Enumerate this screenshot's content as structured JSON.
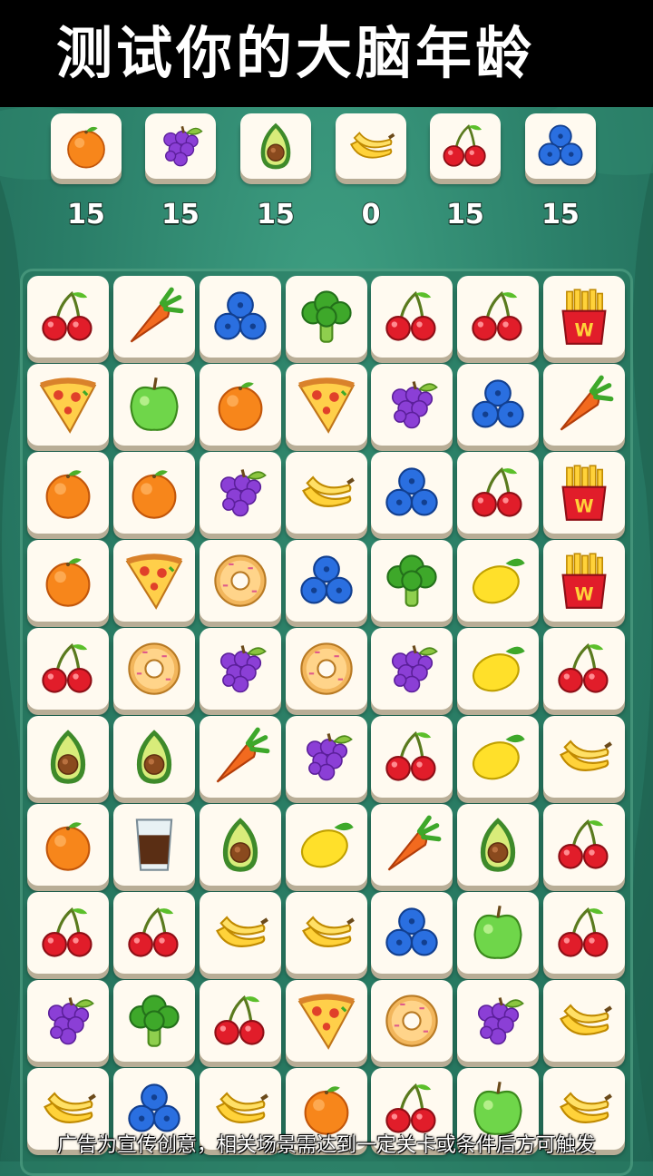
{
  "title": "测试你的大脑年龄",
  "targets": [
    {
      "icon": "orange-icon",
      "count": "15"
    },
    {
      "icon": "grapes-icon",
      "count": "15"
    },
    {
      "icon": "avocado-icon",
      "count": "15"
    },
    {
      "icon": "banana-icon",
      "count": "0"
    },
    {
      "icon": "cherry-icon",
      "count": "15"
    },
    {
      "icon": "blueberry-icon",
      "count": "15"
    }
  ],
  "board": {
    "rows": [
      [
        "cherry-icon",
        "carrot-icon",
        "blueberry-icon",
        "broccoli-icon",
        "cherry-icon",
        "cherry-icon",
        "fries-icon"
      ],
      [
        "pizza-icon",
        "apple-icon",
        "orange-icon",
        "pizza-icon",
        "grapes-icon",
        "blueberry-icon",
        "carrot-icon"
      ],
      [
        "orange-icon",
        "orange-icon",
        "grapes-icon",
        "banana-icon",
        "blueberry-icon",
        "cherry-icon",
        "fries-icon"
      ],
      [
        "orange-icon",
        "pizza-icon",
        "donut-icon",
        "blueberry-icon",
        "broccoli-icon",
        "lemon-icon",
        "fries-icon"
      ],
      [
        "cherry-icon",
        "donut-icon",
        "grapes-icon",
        "donut-icon",
        "grapes-icon",
        "lemon-icon",
        "cherry-icon"
      ],
      [
        "avocado-icon",
        "avocado-icon",
        "carrot-icon",
        "grapes-icon",
        "cherry-icon",
        "lemon-icon",
        "banana-icon"
      ],
      [
        "orange-icon",
        "drink-icon",
        "avocado-icon",
        "lemon-icon",
        "carrot-icon",
        "avocado-icon",
        "cherry-icon"
      ],
      [
        "cherry-icon",
        "cherry-icon",
        "banana-icon",
        "banana-icon",
        "blueberry-icon",
        "apple-icon",
        "cherry-icon"
      ],
      [
        "grapes-icon",
        "broccoli-icon",
        "cherry-icon",
        "pizza-icon",
        "donut-icon",
        "grapes-icon",
        "banana-icon"
      ],
      [
        "banana-icon",
        "blueberry-icon",
        "banana-icon",
        "orange-icon",
        "cherry-icon",
        "apple-icon",
        "banana-icon"
      ]
    ]
  },
  "disclaimer": "广告为宣传创意，相关场景需达到一定关卡或条件后方可触发",
  "colors": {
    "background": "#2a7e68",
    "tile": "#fffaf0",
    "tile_shadow": "#b8ad96",
    "title_bar": "#000000"
  }
}
